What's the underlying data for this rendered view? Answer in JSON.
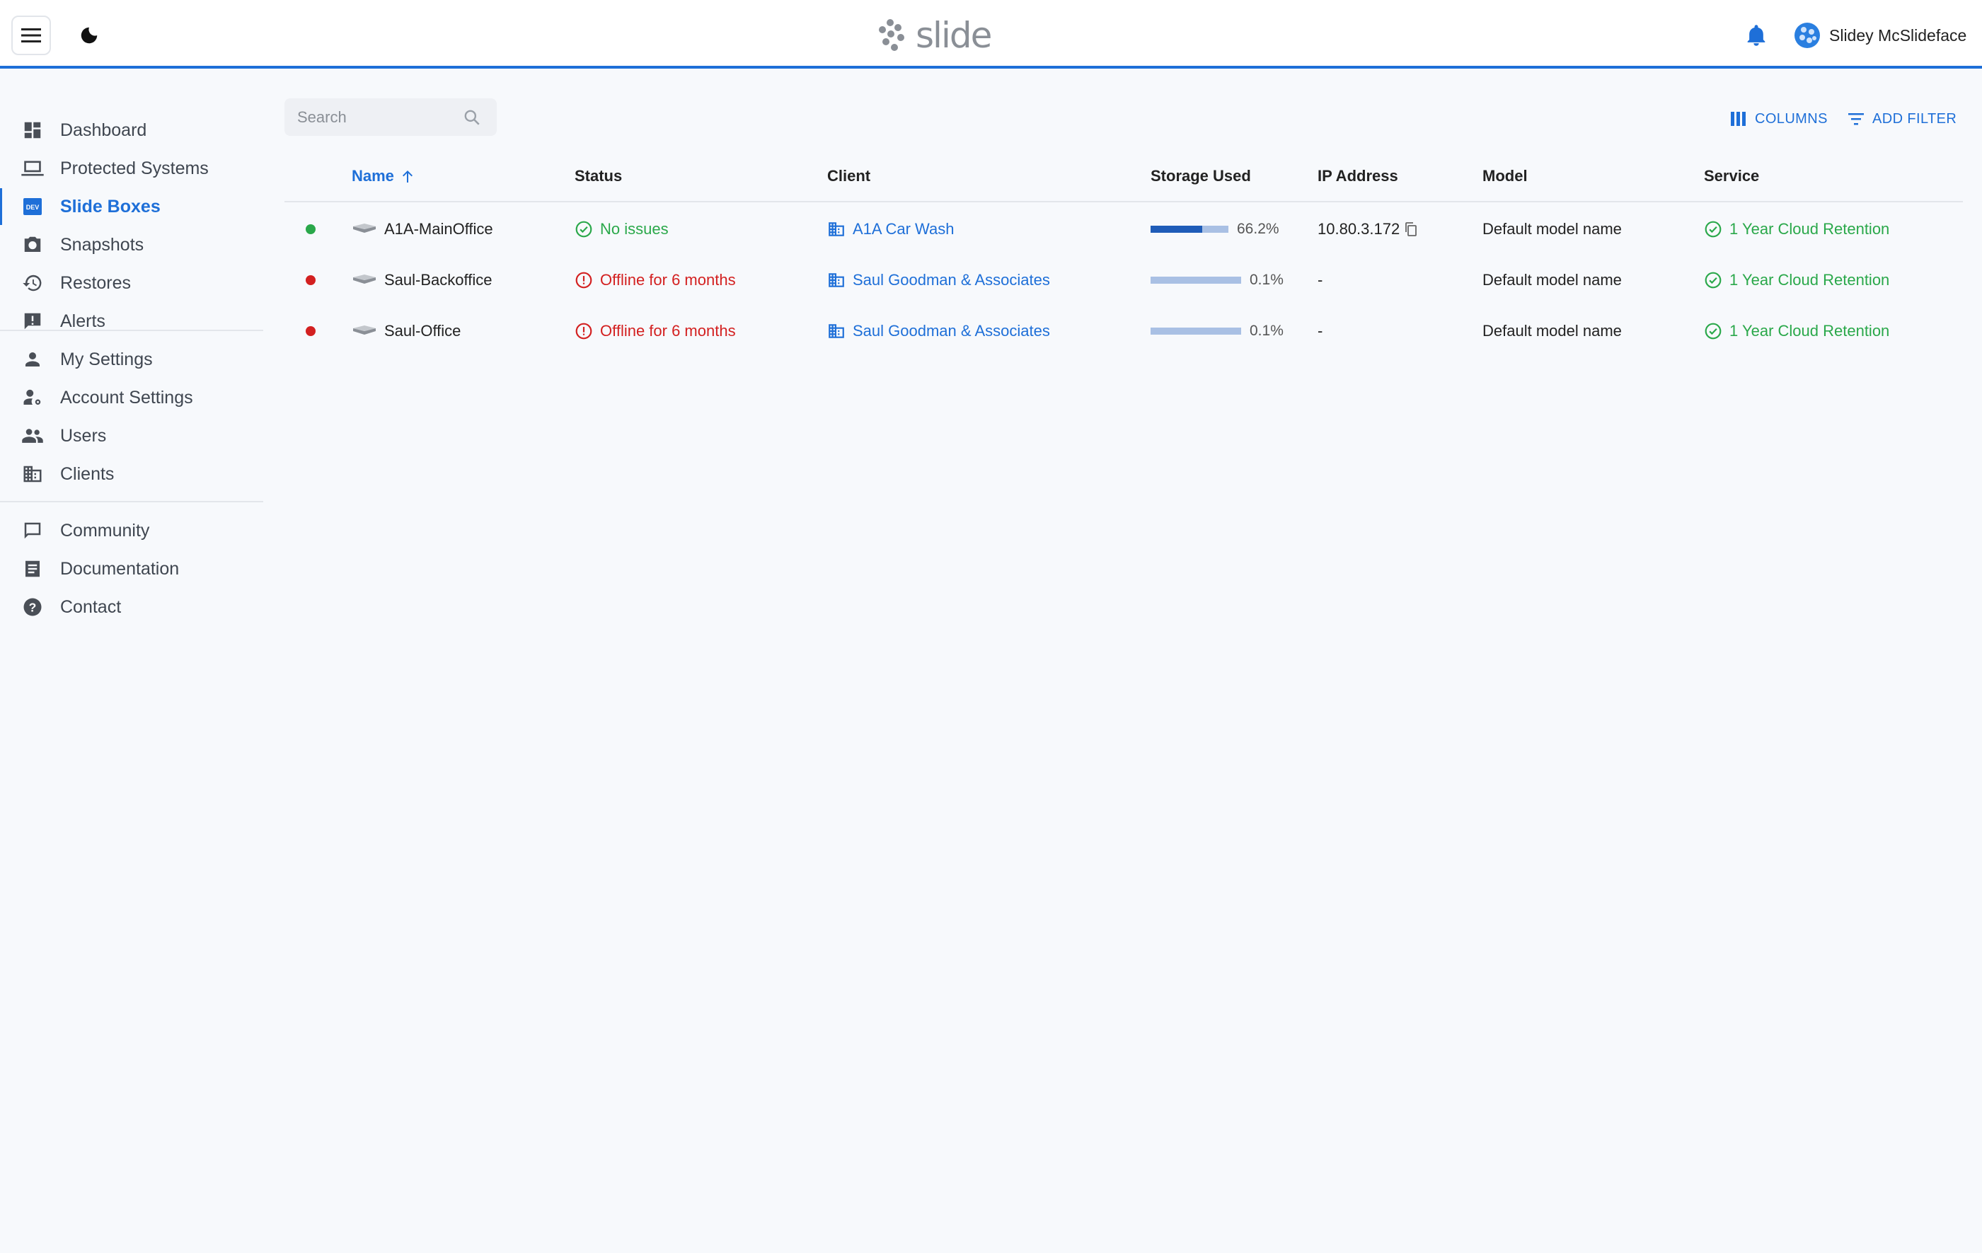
{
  "header": {
    "logo_text": "slide",
    "user_name": "Slidey McSlideface"
  },
  "colors": {
    "accent": "#1e6fd8",
    "ok": "#2aa84a",
    "error": "#d32020"
  },
  "sidebar": {
    "active_item": "Slide Boxes",
    "items": [
      {
        "label": "Dashboard",
        "icon": "dashboard-icon"
      },
      {
        "label": "Protected Systems",
        "icon": "laptop-icon"
      },
      {
        "label": "Slide Boxes",
        "icon": "dev-icon",
        "badge": "DEV"
      },
      {
        "label": "Snapshots",
        "icon": "camera-icon"
      },
      {
        "label": "Restores",
        "icon": "history-icon"
      },
      {
        "label": "Alerts",
        "icon": "alert-icon"
      },
      {
        "label": "My Settings",
        "icon": "person-icon"
      },
      {
        "label": "Account Settings",
        "icon": "person-gear-icon"
      },
      {
        "label": "Users",
        "icon": "people-icon"
      },
      {
        "label": "Clients",
        "icon": "building-icon"
      },
      {
        "label": "Community",
        "icon": "chat-icon"
      },
      {
        "label": "Documentation",
        "icon": "document-icon"
      },
      {
        "label": "Contact",
        "icon": "help-icon"
      }
    ]
  },
  "toolbar": {
    "search_placeholder": "Search",
    "columns_label": "COLUMNS",
    "add_filter_label": "ADD FILTER"
  },
  "table": {
    "columns": [
      "Name",
      "Status",
      "Client",
      "Storage Used",
      "IP Address",
      "Model",
      "Service"
    ],
    "sort_column": "Name",
    "sort_direction": "ascending",
    "rows": [
      {
        "online": true,
        "name": "A1A-MainOffice",
        "status": "No issues",
        "status_ok": true,
        "client": "A1A Car Wash",
        "storage_pct": 66.2,
        "storage_label": "66.2%",
        "ip": "10.80.3.172",
        "model": "Default model name",
        "service": "1 Year Cloud Retention"
      },
      {
        "online": false,
        "name": "Saul-Backoffice",
        "status": "Offline for 6 months",
        "status_ok": false,
        "client": "Saul Goodman & Associates",
        "storage_pct": 0.1,
        "storage_label": "0.1%",
        "ip": "-",
        "model": "Default model name",
        "service": "1 Year Cloud Retention"
      },
      {
        "online": false,
        "name": "Saul-Office",
        "status": "Offline for 6 months",
        "status_ok": false,
        "client": "Saul Goodman & Associates",
        "storage_pct": 0.1,
        "storage_label": "0.1%",
        "ip": "-",
        "model": "Default model name",
        "service": "1 Year Cloud Retention"
      }
    ]
  }
}
